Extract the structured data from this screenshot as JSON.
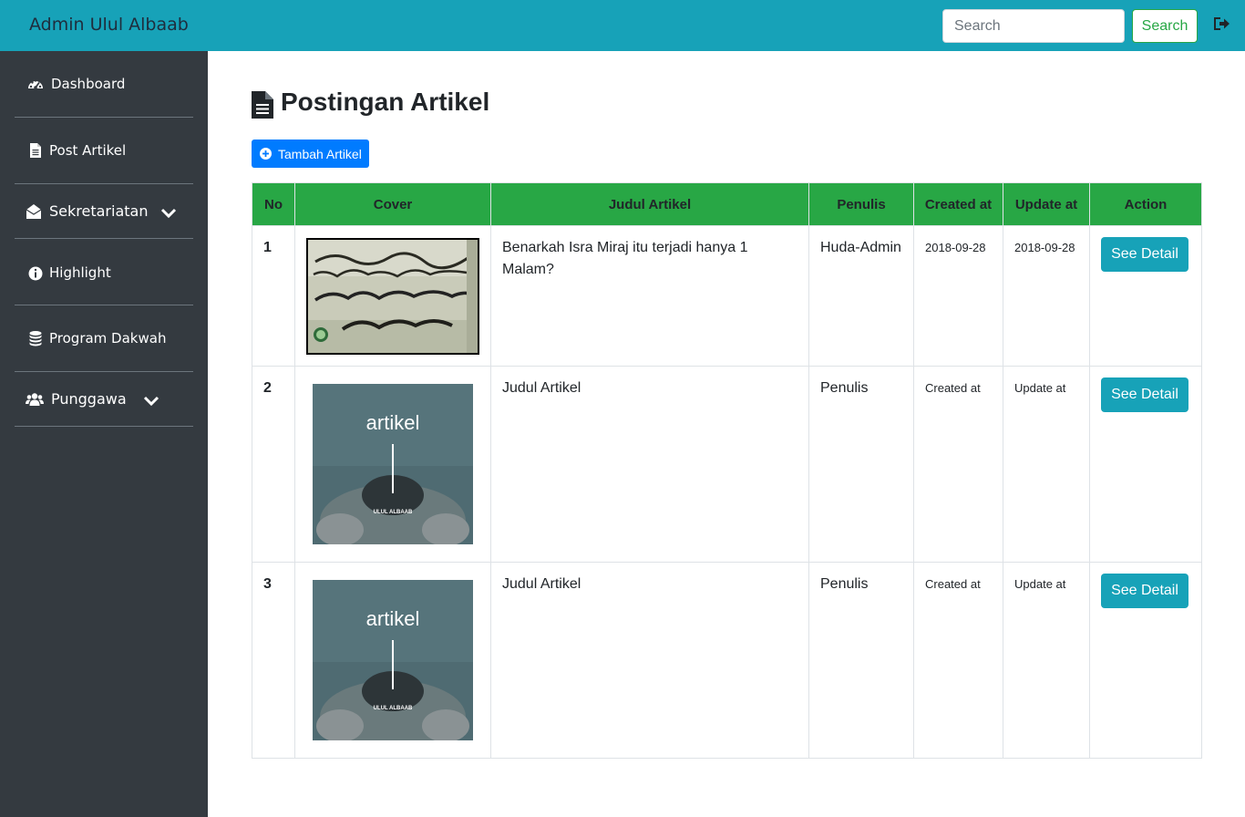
{
  "navbar": {
    "brand": "Admin Ulul Albaab",
    "search_placeholder": "Search",
    "search_button": "Search",
    "logout_icon": "sign-out-icon"
  },
  "sidebar": {
    "items": [
      {
        "label": "Dashboard",
        "icon": "tachometer-icon"
      },
      {
        "label": "Post Artikel",
        "icon": "file-icon"
      },
      {
        "label": "Sekretariatan",
        "icon": "envelope-open-icon",
        "expandable": true
      },
      {
        "label": "Highlight",
        "icon": "info-circle-icon"
      },
      {
        "label": "Program Dakwah",
        "icon": "database-icon"
      },
      {
        "label": "Punggawa",
        "icon": "users-icon",
        "expandable": true
      }
    ]
  },
  "main": {
    "title": "Postingan Artikel",
    "add_button": "Tambah Artikel"
  },
  "table": {
    "headers": [
      "No",
      "Cover",
      "Judul Artikel",
      "Penulis",
      "Created at",
      "Update at",
      "Action"
    ],
    "rows": [
      {
        "no": "1",
        "cover": "quran-page-image",
        "judul": "Benarkah Isra Miraj itu terjadi hanya 1 Malam?",
        "penulis": "Huda-Admin",
        "created": "2018-09-28",
        "updated": "2018-09-28",
        "action": "See Detail"
      },
      {
        "no": "2",
        "cover": "artikel-placeholder-image",
        "cover_title": "artikel",
        "cover_sub": "ULUL ALBAAB",
        "judul": "Judul Artikel",
        "penulis": "Penulis",
        "created": "Created at",
        "updated": "Update at",
        "action": "See Detail"
      },
      {
        "no": "3",
        "cover": "artikel-placeholder-image",
        "cover_title": "artikel",
        "cover_sub": "ULUL ALBAAB",
        "judul": "Judul Artikel",
        "penulis": "Penulis",
        "created": "Created at",
        "updated": "Update at",
        "action": "See Detail"
      }
    ]
  },
  "colors": {
    "navbar": "#17a2b8",
    "sidebar": "#343a40",
    "table_header": "#28a745",
    "primary": "#007bff",
    "info_button": "#17a2b8"
  }
}
